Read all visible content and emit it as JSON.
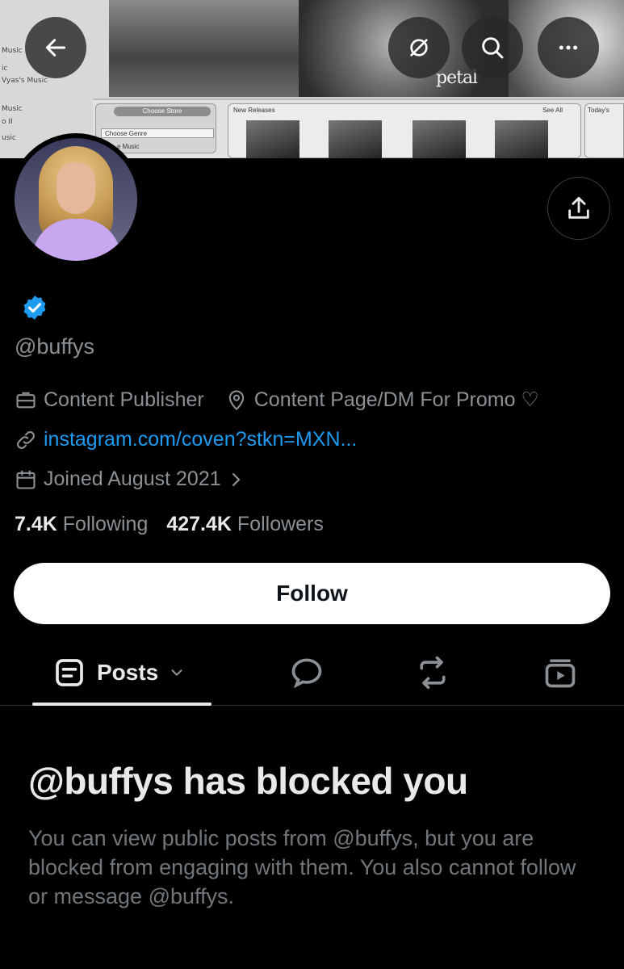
{
  "banner": {
    "left_labels": [
      "Music",
      "ic",
      "Vyas's Music",
      "Music",
      "o II",
      "usic"
    ],
    "store_button": "Choose Store",
    "genre_select": "Choose Genre",
    "music_label": "e Music",
    "new_releases": "New Releases",
    "see_all": "See All",
    "todays": "Today's",
    "album_text": "petal"
  },
  "top_buttons": {
    "back": "back-arrow-icon",
    "grok": "grok-icon",
    "search": "search-icon",
    "more": "more-icon"
  },
  "profile": {
    "handle": "@buffys",
    "category": "Content Publisher",
    "location": "Content Page/DM For Promo ♡",
    "website": "instagram.com/coven?stkn=MXN...",
    "joined": "Joined August 2021",
    "following_count": "7.4K",
    "following_label": "Following",
    "followers_count": "427.4K",
    "followers_label": "Followers"
  },
  "actions": {
    "follow_label": "Follow"
  },
  "tabs": {
    "posts_label": "Posts"
  },
  "blocked": {
    "title": "@buffys has blocked you",
    "message": "You can view public posts from @buffys, but you are blocked from engaging with them. You also cannot follow or message @buffys."
  },
  "colors": {
    "background": "#000000",
    "link": "#1d9bf0",
    "verified": "#1d9bf0",
    "muted_text": "#71767b"
  }
}
